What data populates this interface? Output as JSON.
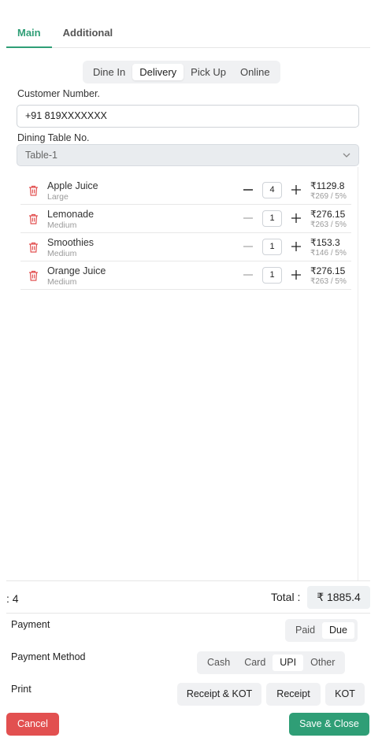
{
  "tabs": [
    {
      "label": "Main",
      "active": true
    },
    {
      "label": "Additional",
      "active": false
    }
  ],
  "order_types": [
    {
      "label": "Dine In",
      "active": false
    },
    {
      "label": "Delivery",
      "active": true
    },
    {
      "label": "Pick Up",
      "active": false
    },
    {
      "label": "Online",
      "active": false
    }
  ],
  "customer": {
    "label": "Customer Number.",
    "value": "+91 819XXXXXXX"
  },
  "table": {
    "label": "Dining Table No.",
    "value": "Table-1"
  },
  "items": [
    {
      "name": "Apple Juice",
      "size": "Large",
      "qty": "4",
      "price": "₹1129.8",
      "unit": "₹269 / 5%"
    },
    {
      "name": "Lemonade",
      "size": "Medium",
      "qty": "1",
      "price": "₹276.15",
      "unit": "₹263 / 5%"
    },
    {
      "name": "Smoothies",
      "size": "Medium",
      "qty": "1",
      "price": "₹153.3",
      "unit": "₹146 / 5%"
    },
    {
      "name": "Orange Juice",
      "size": "Medium",
      "qty": "1",
      "price": "₹276.15",
      "unit": "₹263 / 5%"
    }
  ],
  "summary": {
    "count_text": ": 4",
    "total_label": "Total :",
    "total_value": "₹ 1885.4"
  },
  "payment": {
    "label": "Payment",
    "options": [
      "Paid",
      "Due"
    ],
    "selected": "Due"
  },
  "payment_method": {
    "label": "Payment Method",
    "options": [
      "Cash",
      "Card",
      "UPI",
      "Other"
    ],
    "selected": "UPI"
  },
  "print": {
    "label": "Print",
    "buttons": [
      "Receipt & KOT",
      "Receipt",
      "KOT"
    ]
  },
  "actions": {
    "cancel": "Cancel",
    "save": "Save & Close"
  },
  "colors": {
    "accent": "#2f9e76",
    "danger": "#e25050"
  }
}
